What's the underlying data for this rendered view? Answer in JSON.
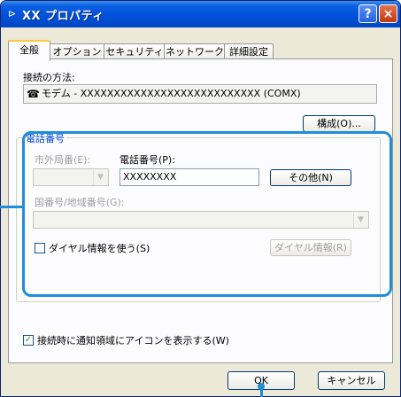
{
  "window": {
    "title": "XX プロパティ",
    "help_label": "?",
    "close_label": "×"
  },
  "tabs": [
    {
      "label": "全般",
      "active": true
    },
    {
      "label": "オプション",
      "active": false
    },
    {
      "label": "セキュリティ",
      "active": false
    },
    {
      "label": "ネットワーク",
      "active": false
    },
    {
      "label": "詳細設定",
      "active": false
    }
  ],
  "general": {
    "connect_using_label": "接続の方法:",
    "device_name": "モデム - XXXXXXXXXXXXXXXXXXXXXXXXXXX (COMX)",
    "configure_label": "構成(O)..."
  },
  "phone": {
    "group_label": "電話番号",
    "area_code_label": "市外局番(E):",
    "phone_number_label": "電話番号(P):",
    "phone_number_value": "XXXXXXXX",
    "other_label": "その他(N)",
    "country_label": "国番号/地域番号(G):",
    "dialing_rules_label": "ダイヤル情報を使う(S)",
    "dialing_rules_checked": false,
    "dialing_rules_button": "ダイヤル情報(R)"
  },
  "notify": {
    "label": "接続時に通知領域にアイコンを表示する(W)",
    "checked": true
  },
  "footer": {
    "ok_label": "OK",
    "cancel_label": "キャンセル"
  },
  "colors": {
    "highlight": "#1d8fd8",
    "titlebar": "#0050d8"
  }
}
